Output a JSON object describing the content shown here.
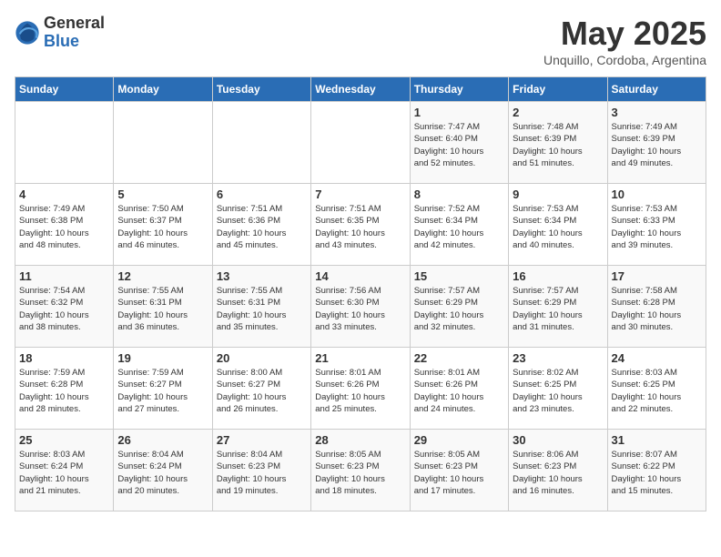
{
  "logo": {
    "general": "General",
    "blue": "Blue"
  },
  "header": {
    "title": "May 2025",
    "location": "Unquillo, Cordoba, Argentina"
  },
  "days_of_week": [
    "Sunday",
    "Monday",
    "Tuesday",
    "Wednesday",
    "Thursday",
    "Friday",
    "Saturday"
  ],
  "weeks": [
    [
      {
        "num": "",
        "text": ""
      },
      {
        "num": "",
        "text": ""
      },
      {
        "num": "",
        "text": ""
      },
      {
        "num": "",
        "text": ""
      },
      {
        "num": "1",
        "text": "Sunrise: 7:47 AM\nSunset: 6:40 PM\nDaylight: 10 hours\nand 52 minutes."
      },
      {
        "num": "2",
        "text": "Sunrise: 7:48 AM\nSunset: 6:39 PM\nDaylight: 10 hours\nand 51 minutes."
      },
      {
        "num": "3",
        "text": "Sunrise: 7:49 AM\nSunset: 6:39 PM\nDaylight: 10 hours\nand 49 minutes."
      }
    ],
    [
      {
        "num": "4",
        "text": "Sunrise: 7:49 AM\nSunset: 6:38 PM\nDaylight: 10 hours\nand 48 minutes."
      },
      {
        "num": "5",
        "text": "Sunrise: 7:50 AM\nSunset: 6:37 PM\nDaylight: 10 hours\nand 46 minutes."
      },
      {
        "num": "6",
        "text": "Sunrise: 7:51 AM\nSunset: 6:36 PM\nDaylight: 10 hours\nand 45 minutes."
      },
      {
        "num": "7",
        "text": "Sunrise: 7:51 AM\nSunset: 6:35 PM\nDaylight: 10 hours\nand 43 minutes."
      },
      {
        "num": "8",
        "text": "Sunrise: 7:52 AM\nSunset: 6:34 PM\nDaylight: 10 hours\nand 42 minutes."
      },
      {
        "num": "9",
        "text": "Sunrise: 7:53 AM\nSunset: 6:34 PM\nDaylight: 10 hours\nand 40 minutes."
      },
      {
        "num": "10",
        "text": "Sunrise: 7:53 AM\nSunset: 6:33 PM\nDaylight: 10 hours\nand 39 minutes."
      }
    ],
    [
      {
        "num": "11",
        "text": "Sunrise: 7:54 AM\nSunset: 6:32 PM\nDaylight: 10 hours\nand 38 minutes."
      },
      {
        "num": "12",
        "text": "Sunrise: 7:55 AM\nSunset: 6:31 PM\nDaylight: 10 hours\nand 36 minutes."
      },
      {
        "num": "13",
        "text": "Sunrise: 7:55 AM\nSunset: 6:31 PM\nDaylight: 10 hours\nand 35 minutes."
      },
      {
        "num": "14",
        "text": "Sunrise: 7:56 AM\nSunset: 6:30 PM\nDaylight: 10 hours\nand 33 minutes."
      },
      {
        "num": "15",
        "text": "Sunrise: 7:57 AM\nSunset: 6:29 PM\nDaylight: 10 hours\nand 32 minutes."
      },
      {
        "num": "16",
        "text": "Sunrise: 7:57 AM\nSunset: 6:29 PM\nDaylight: 10 hours\nand 31 minutes."
      },
      {
        "num": "17",
        "text": "Sunrise: 7:58 AM\nSunset: 6:28 PM\nDaylight: 10 hours\nand 30 minutes."
      }
    ],
    [
      {
        "num": "18",
        "text": "Sunrise: 7:59 AM\nSunset: 6:28 PM\nDaylight: 10 hours\nand 28 minutes."
      },
      {
        "num": "19",
        "text": "Sunrise: 7:59 AM\nSunset: 6:27 PM\nDaylight: 10 hours\nand 27 minutes."
      },
      {
        "num": "20",
        "text": "Sunrise: 8:00 AM\nSunset: 6:27 PM\nDaylight: 10 hours\nand 26 minutes."
      },
      {
        "num": "21",
        "text": "Sunrise: 8:01 AM\nSunset: 6:26 PM\nDaylight: 10 hours\nand 25 minutes."
      },
      {
        "num": "22",
        "text": "Sunrise: 8:01 AM\nSunset: 6:26 PM\nDaylight: 10 hours\nand 24 minutes."
      },
      {
        "num": "23",
        "text": "Sunrise: 8:02 AM\nSunset: 6:25 PM\nDaylight: 10 hours\nand 23 minutes."
      },
      {
        "num": "24",
        "text": "Sunrise: 8:03 AM\nSunset: 6:25 PM\nDaylight: 10 hours\nand 22 minutes."
      }
    ],
    [
      {
        "num": "25",
        "text": "Sunrise: 8:03 AM\nSunset: 6:24 PM\nDaylight: 10 hours\nand 21 minutes."
      },
      {
        "num": "26",
        "text": "Sunrise: 8:04 AM\nSunset: 6:24 PM\nDaylight: 10 hours\nand 20 minutes."
      },
      {
        "num": "27",
        "text": "Sunrise: 8:04 AM\nSunset: 6:23 PM\nDaylight: 10 hours\nand 19 minutes."
      },
      {
        "num": "28",
        "text": "Sunrise: 8:05 AM\nSunset: 6:23 PM\nDaylight: 10 hours\nand 18 minutes."
      },
      {
        "num": "29",
        "text": "Sunrise: 8:05 AM\nSunset: 6:23 PM\nDaylight: 10 hours\nand 17 minutes."
      },
      {
        "num": "30",
        "text": "Sunrise: 8:06 AM\nSunset: 6:23 PM\nDaylight: 10 hours\nand 16 minutes."
      },
      {
        "num": "31",
        "text": "Sunrise: 8:07 AM\nSunset: 6:22 PM\nDaylight: 10 hours\nand 15 minutes."
      }
    ]
  ]
}
